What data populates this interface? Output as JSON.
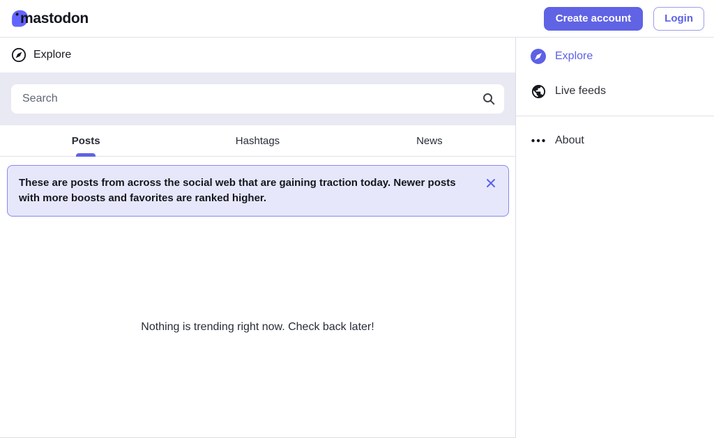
{
  "header": {
    "brand": "mastodon",
    "create_account_label": "Create account",
    "login_label": "Login"
  },
  "explore": {
    "title": "Explore",
    "search": {
      "placeholder": "Search"
    },
    "tabs": [
      {
        "label": "Posts",
        "active": true
      },
      {
        "label": "Hashtags",
        "active": false
      },
      {
        "label": "News",
        "active": false
      }
    ],
    "banner": {
      "text": "These are posts from across the social web that are gaining traction today. Newer posts with more boosts and favorites are ranked higher."
    },
    "empty_message": "Nothing is trending right now. Check back later!"
  },
  "sidebar": {
    "items": [
      {
        "label": "Explore",
        "icon": "compass-icon",
        "active": true
      },
      {
        "label": "Live feeds",
        "icon": "globe-icon",
        "active": false
      },
      {
        "label": "About",
        "icon": "ellipsis-icon",
        "active": false
      }
    ]
  },
  "colors": {
    "accent": "#6063e4",
    "brand_purple": "#6364ff",
    "banner_bg": "#e7e7fb",
    "banner_border": "#8589f0",
    "search_section_bg": "#e9e9f3"
  }
}
